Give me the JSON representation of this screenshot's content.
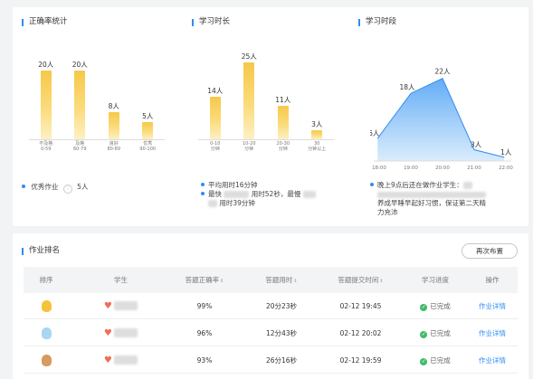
{
  "accuracy": {
    "title": "正确率统计",
    "chart_data": {
      "type": "bar",
      "categories": [
        [
          "不及格",
          "0-59"
        ],
        [
          "及格",
          "60-79"
        ],
        [
          "良好",
          "80-89"
        ],
        [
          "优秀",
          "90-100"
        ]
      ],
      "values": [
        20,
        20,
        8,
        5
      ],
      "value_labels": [
        "20人",
        "20人",
        "8人",
        "5人"
      ],
      "ylim": [
        0,
        25
      ]
    },
    "excellent_label": "优秀作业",
    "excellent_count": "5人"
  },
  "duration": {
    "title": "学习时长",
    "chart_data": {
      "type": "bar",
      "categories": [
        [
          "0-10",
          "分钟"
        ],
        [
          "10-20",
          "分钟"
        ],
        [
          "20-30",
          "分钟"
        ],
        [
          "30",
          "分钟以上"
        ]
      ],
      "values": [
        14,
        25,
        11,
        3
      ],
      "value_labels": [
        "14人",
        "25人",
        "11人",
        "3人"
      ],
      "ylim": [
        0,
        28
      ]
    },
    "avg_text": "平均用时16分钟",
    "fast_prefix": "最快",
    "fast_time": "用时52秒，最慢",
    "slow_time": "用时39分钟"
  },
  "period": {
    "title": "学习时段",
    "chart_data": {
      "type": "area",
      "x": [
        "18:00",
        "19:00",
        "20:00",
        "21:00",
        "22:00"
      ],
      "points": [
        {
          "t": "17:57",
          "v": 6
        },
        {
          "t": "19:00",
          "v": 18
        },
        {
          "t": "20:00",
          "v": 22
        },
        {
          "t": "21:00",
          "v": 3
        },
        {
          "t": "21:57",
          "v": 1
        }
      ],
      "value_labels": [
        "6人",
        "18人",
        "22人",
        "3人",
        "1人"
      ],
      "ylim": [
        0,
        26
      ]
    },
    "note_line1": "晚上9点后还在做作业学生：",
    "note_line2": "养成早睡早起好习惯，保证第二天精",
    "note_line3": "力充沛"
  },
  "ranking": {
    "title": "作业排名",
    "redo_label": "再次布置",
    "columns": [
      "排序",
      "学生",
      "答题正确率",
      "答题用时",
      "答题提交时间",
      "学习进度",
      "操作"
    ],
    "sort_mark": "⇕",
    "rows": [
      {
        "medal_color": "#f5c33b",
        "accuracy": "99%",
        "time": "20分23秒",
        "submitted": "02-12 19:45",
        "progress": "已完成",
        "action": "作业详情"
      },
      {
        "medal_color": "#a9d6f2",
        "accuracy": "96%",
        "time": "12分43秒",
        "submitted": "02-12 20:02",
        "progress": "已完成",
        "action": "作业详情"
      },
      {
        "medal_color": "#d79a5f",
        "accuracy": "93%",
        "time": "26分16秒",
        "submitted": "02-12 19:59",
        "progress": "已完成",
        "action": "作业详情"
      }
    ]
  }
}
